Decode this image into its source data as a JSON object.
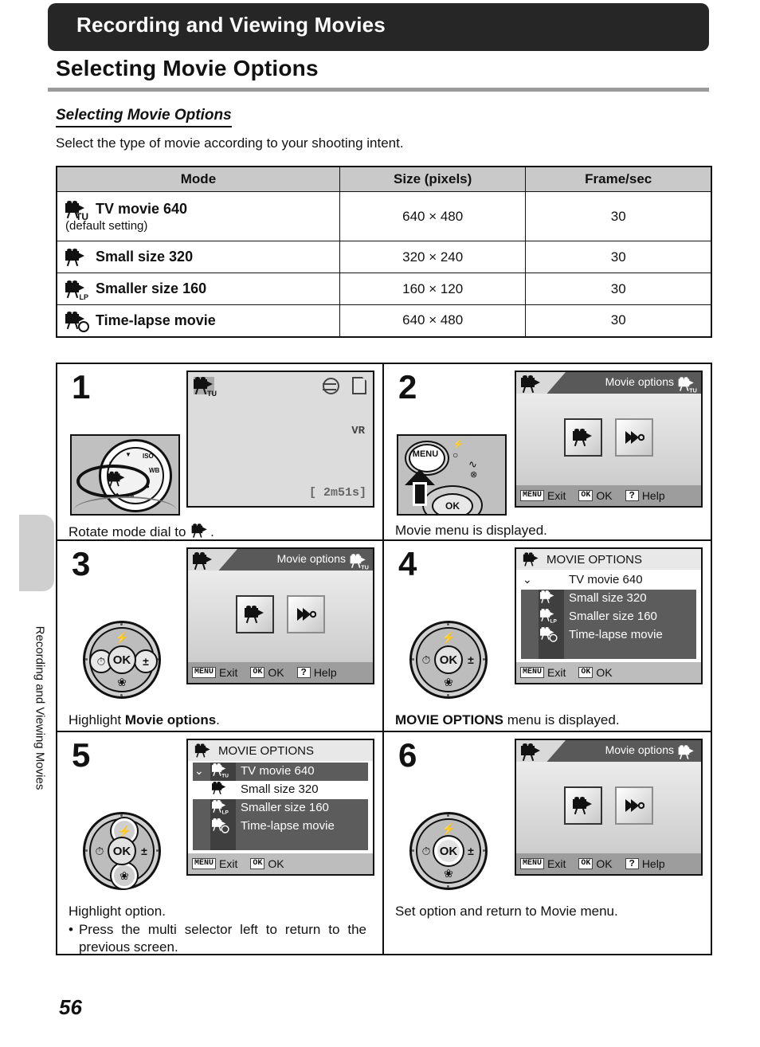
{
  "header": {
    "chapter_bar": "Recording and Viewing Movies",
    "page_title": "Selecting Movie Options"
  },
  "section": {
    "heading": "Selecting Movie Options",
    "intro": "Select the type of movie according to your shooting intent."
  },
  "sidebar": {
    "label": "Recording and Viewing Movies"
  },
  "footer": {
    "page_number": "56"
  },
  "table": {
    "columns": [
      "Mode",
      "Size (pixels)",
      "Frame/sec"
    ],
    "rows": [
      {
        "icon": "movie-tv-icon",
        "mode": "TV movie 640",
        "note": "(default setting)",
        "size": "640 × 480",
        "fps": "30"
      },
      {
        "icon": "movie-small-icon",
        "mode": "Small size 320",
        "note": "",
        "size": "320 × 240",
        "fps": "30"
      },
      {
        "icon": "movie-lp-icon",
        "mode": "Smaller size 160",
        "note": "",
        "size": "160 × 120",
        "fps": "30"
      },
      {
        "icon": "movie-timelapse-icon",
        "mode": "Time-lapse movie",
        "note": "",
        "size": "640 × 480",
        "fps": "30"
      }
    ]
  },
  "steps": [
    {
      "number": "1",
      "caption_pre": "Rotate mode dial to ",
      "caption_post": ".",
      "art": "mode-dial-photo",
      "lcd": {
        "type": "shooting",
        "mode_icon": "movie-tv-icon",
        "vr": "VR",
        "time_remaining": "2m51s",
        "bracket_left": "[",
        "bracket_right": "]"
      }
    },
    {
      "number": "2",
      "caption": "Movie menu is displayed.",
      "art": "menu-button-photo",
      "menu_button_label": "MENU",
      "lcd": {
        "type": "menu",
        "title": "Movie options",
        "corner_icon": "movie-tv-icon",
        "items": [
          "movie-options-icon",
          "playback-icon"
        ],
        "selected_index": 0,
        "bottom": [
          {
            "key": "MENU",
            "label": "Exit"
          },
          {
            "key": "OK",
            "label": "OK"
          },
          {
            "key": "?",
            "label": "Help"
          }
        ]
      }
    },
    {
      "number": "3",
      "caption_pre": "Highlight ",
      "caption_bold": "Movie options",
      "caption_post": ".",
      "art": "multi-selector",
      "selector": {
        "up": "flash-icon",
        "down": "macro-icon",
        "left": "self-timer-icon",
        "right": "exposure-comp-icon",
        "center": "OK",
        "emphasis": "none"
      },
      "lcd": {
        "type": "menu",
        "title": "Movie options",
        "corner_icon": "movie-tv-icon",
        "items": [
          "movie-options-icon",
          "playback-icon"
        ],
        "selected_index": 0,
        "bottom": [
          {
            "key": "MENU",
            "label": "Exit"
          },
          {
            "key": "OK",
            "label": "OK"
          },
          {
            "key": "?",
            "label": "Help"
          }
        ]
      }
    },
    {
      "number": "4",
      "caption_bold": "MOVIE OPTIONS",
      "caption_post": " menu is displayed.",
      "art": "multi-selector",
      "selector": {
        "up": "flash-icon",
        "down": "macro-icon",
        "left": "self-timer-icon",
        "right": "exposure-comp-icon",
        "center": "OK",
        "emphasis": "none"
      },
      "lcd": {
        "type": "list",
        "title": "MOVIE OPTIONS",
        "title_icon": "movie-options-icon",
        "items": [
          {
            "label": "TV movie 640",
            "icon": "movie-tv-icon",
            "checked": true
          },
          {
            "label": "Small size 320",
            "icon": "movie-small-icon",
            "checked": false
          },
          {
            "label": "Smaller size 160",
            "icon": "movie-lp-icon",
            "checked": false
          },
          {
            "label": "Time-lapse movie",
            "icon": "movie-timelapse-icon",
            "checked": false
          }
        ],
        "highlight_index": 0,
        "bottom": [
          {
            "key": "MENU",
            "label": "Exit"
          },
          {
            "key": "OK",
            "label": "OK"
          }
        ]
      }
    },
    {
      "number": "5",
      "caption": "Highlight option.",
      "bullet": "Press the multi selector left to return to the previous screen.",
      "art": "multi-selector",
      "selector": {
        "up": "flash-icon",
        "down": "macro-icon",
        "left": "self-timer-icon",
        "right": "exposure-comp-icon",
        "center": "OK",
        "emphasis": "up-down"
      },
      "lcd": {
        "type": "list",
        "title": "MOVIE OPTIONS",
        "title_icon": "movie-options-icon",
        "items": [
          {
            "label": "TV movie 640",
            "icon": "movie-tv-icon",
            "checked": true
          },
          {
            "label": "Small size 320",
            "icon": "movie-small-icon",
            "checked": false
          },
          {
            "label": "Smaller size 160",
            "icon": "movie-lp-icon",
            "checked": false
          },
          {
            "label": "Time-lapse movie",
            "icon": "movie-timelapse-icon",
            "checked": false
          }
        ],
        "highlight_index": 1,
        "bottom": [
          {
            "key": "MENU",
            "label": "Exit"
          },
          {
            "key": "OK",
            "label": "OK"
          }
        ]
      }
    },
    {
      "number": "6",
      "caption": "Set option and return to Movie menu.",
      "art": "multi-selector",
      "selector": {
        "up": "flash-icon",
        "down": "macro-icon",
        "left": "self-timer-icon",
        "right": "exposure-comp-icon",
        "center": "OK",
        "emphasis": "center"
      },
      "lcd": {
        "type": "menu",
        "title": "Movie options",
        "corner_icon": "movie-small-icon",
        "items": [
          "movie-options-icon",
          "playback-icon"
        ],
        "selected_index": 0,
        "bottom": [
          {
            "key": "MENU",
            "label": "Exit"
          },
          {
            "key": "OK",
            "label": "OK"
          },
          {
            "key": "?",
            "label": "Help"
          }
        ]
      }
    }
  ],
  "glyphs": {
    "flash": "⚡",
    "macro": "❀",
    "self_timer": "⏱",
    "exposure": "±",
    "check": "✓",
    "times": "×"
  }
}
